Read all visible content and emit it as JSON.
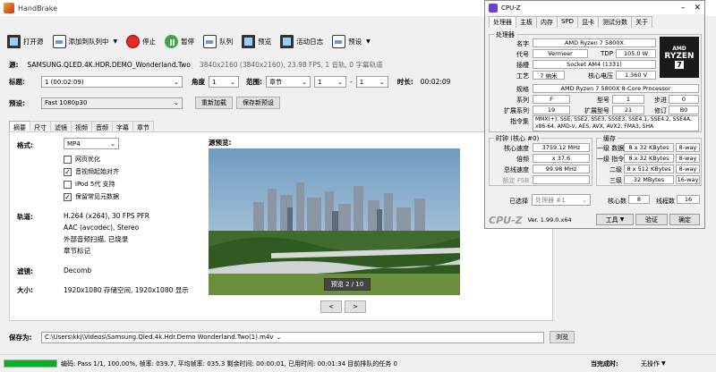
{
  "hb": {
    "title": "HandBrake",
    "toolbar": [
      "打开源",
      "添加到队列中",
      "停止",
      "暂停",
      "队列",
      "预览",
      "活动日志",
      "预设"
    ],
    "source_label": "源:",
    "source_name": "SAMSUNG.QLED.4K.HDR.DEMO_Wonderland.Two",
    "source_info": "3840x2160 (3840x2160), 23.98 FPS, 1 音轨, 0 字幕轨道",
    "title_label": "标题:",
    "title_value": "1 (00:02:09)",
    "angle_label": "角度",
    "angle_value": "1",
    "range_label": "范围:",
    "range_type": "章节",
    "range_from": "1",
    "range_dash": "-",
    "range_to": "1",
    "duration_label": "时长:",
    "duration_value": "00:02:09",
    "preset_label": "预设:",
    "preset_value": "Fast 1080p30",
    "reload_btn": "重新加载",
    "save_preset_btn": "保存新预设",
    "tabs": [
      "摘要",
      "尺寸",
      "滤镜",
      "视频",
      "音频",
      "字幕",
      "章节"
    ],
    "format_label": "格式:",
    "format_value": "MP4",
    "checks": [
      {
        "label": "网页优化",
        "checked": false
      },
      {
        "label": "音视频起始对齐",
        "checked": true
      },
      {
        "label": "iPod 5代 支持",
        "checked": false
      },
      {
        "label": "保留常见元数据",
        "checked": true
      }
    ],
    "tracks_label": "轨道:",
    "tracks": [
      "H.264 (x264), 30 FPS PFR",
      "AAC (avcodec), Stereo",
      "外部音频扫描, 已烧录",
      "章节标记"
    ],
    "filters_label": "滤镜:",
    "filters_value": "Decomb",
    "size_label": "大小:",
    "size_value": "1920x1080 存储空间, 1920x1080 显示",
    "preview_label": "源预览:",
    "preview_counter": "预览 2 / 10",
    "prev": "<",
    "next": ">",
    "save_as_label": "保存为:",
    "save_as_value": "C:\\Users\\kkj\\Videos\\Samsung.Qled.4k.Hdr.Demo Wonderland.Two(1).m4v",
    "browse": "浏览",
    "status": "编码: Pass 1/1,  100.00%,  帧率: 039.7,  平均帧率: 035.3  剩余时间: 00:00:01,  已用时间: 00:01:34  目前排队的任务 0",
    "progress": 1.0,
    "when_done_label": "当完成时:",
    "when_done_value": "无操作"
  },
  "cz": {
    "title": "CPU-Z",
    "tabs": [
      "处理器",
      "主板",
      "内存",
      "SPD",
      "显卡",
      "测试分数",
      "关于"
    ],
    "proc_group": "处理器",
    "name_l": "名字",
    "name": "AMD Ryzen 7 5800X",
    "code_l": "代号",
    "code": "Vermeer",
    "tdp_l": "TDP",
    "tdp": "105.0 W",
    "socket_l": "插槽",
    "socket": "Socket AM4 (1331)",
    "tech_l": "工艺",
    "tech": "7 纳米",
    "volt_l": "核心电压",
    "volt": "1.360 V",
    "spec_l": "规格",
    "spec": "AMD Ryzen 7 5800X 8-Core Processor",
    "family_l": "系列",
    "family": "F",
    "model_l": "型号",
    "model": "1",
    "step_l": "步进",
    "step": "0",
    "extfam_l": "扩展系列",
    "extfam": "19",
    "extmod_l": "扩展型号",
    "extmod": "21",
    "rev_l": "修订",
    "rev": "B0",
    "instr_l": "指令集",
    "instr": "MMX(+), SSE, SSE2, SSE3, SSSE3, SSE4.1, SSE4.2, SSE4A, x86-64, AMD-V, AES, AVX, AVX2, FMA3, SHA",
    "logo_line1": "RYZEN",
    "logo_line2": "7",
    "logo_amd": "AMD",
    "clock_group": "时钟 (核心 #0)",
    "core_speed_l": "核心速度",
    "core_speed": "3759.12 MHz",
    "mult_l": "倍频",
    "mult": "x 37.6",
    "bus_l": "总线速度",
    "bus": "99.98 MHz",
    "fsb_l": "额定 FSB",
    "fsb": "",
    "cache_group": "缓存",
    "l1d_l": "一级 数据",
    "l1d": "8 x 32 KBytes",
    "l1d_w": "8-way",
    "l1i_l": "一级 指令",
    "l1i": "8 x 32 KBytes",
    "l1i_w": "8-way",
    "l2_l": "二级",
    "l2": "8 x 512 KBytes",
    "l2_w": "8-way",
    "l3_l": "三级",
    "l3": "32 MBytes",
    "l3_w": "16-way",
    "selected_l": "已选择",
    "selected": "处理器 #1",
    "cores_l": "核心数",
    "cores": "8",
    "threads_l": "线程数",
    "threads": "16",
    "brand": "CPU-Z",
    "version": "Ver. 1.99.0.x64",
    "tools": "工具",
    "validate": "验证",
    "ok": "确定"
  }
}
